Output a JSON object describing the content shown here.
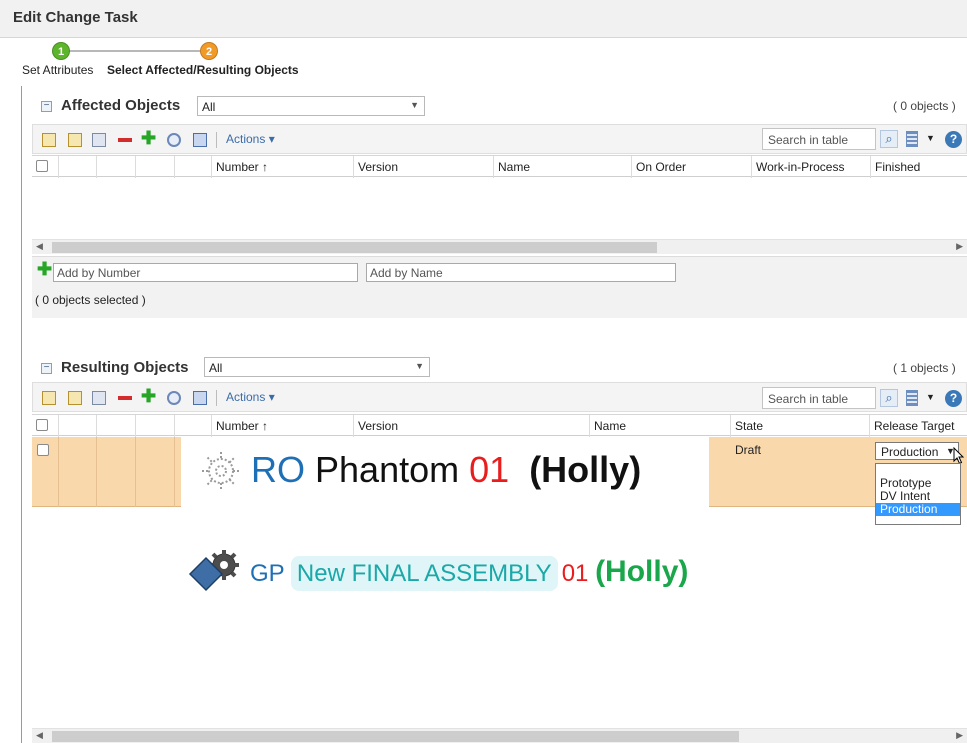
{
  "window": {
    "title": "Edit Change Task"
  },
  "steps": [
    {
      "number": "1",
      "label": "Set Attributes",
      "color": "#5cb52a"
    },
    {
      "number": "2",
      "label": "Select Affected/Resulting Objects",
      "color": "#f29a28"
    }
  ],
  "affected": {
    "title": "Affected Objects",
    "filter": "All",
    "count": "( 0 objects )",
    "toolbar": {
      "actions": "Actions"
    },
    "search_placeholder": "Search in table",
    "columns": [
      "Number",
      "Version",
      "Name",
      "On Order",
      "Work-in-Process",
      "Finished"
    ],
    "sort_indicator": "↑",
    "add_by_number_placeholder": "Add by Number",
    "add_by_name_placeholder": "Add by Name",
    "selected_status": "( 0 objects selected )"
  },
  "resulting": {
    "title": "Resulting Objects",
    "filter": "All",
    "count": "( 1 objects )",
    "toolbar": {
      "actions": "Actions"
    },
    "search_placeholder": "Search in table",
    "columns": [
      "Number",
      "Version",
      "Name",
      "State",
      "Release Target"
    ],
    "sort_indicator": "↑",
    "row": {
      "state": "Draft",
      "release_target": "Production",
      "release_options": [
        "Prototype",
        "DV Intent",
        "Production"
      ]
    }
  },
  "overlays": {
    "phantom": {
      "prefix": "RO",
      "text": "Phantom",
      "num": "01",
      "owner": "(Holly)"
    },
    "assembly": {
      "prefix": "GP",
      "text": "New FINAL ASSEMBLY",
      "num": "01",
      "owner": "(Holly)"
    }
  },
  "colors": {
    "accent_blue": "#1e6fb5",
    "highlight_row": "#f9d9ac",
    "red_num": "#e81d1d",
    "green_owner": "#1aa64a",
    "assembly_text": "#1aa8a8"
  }
}
